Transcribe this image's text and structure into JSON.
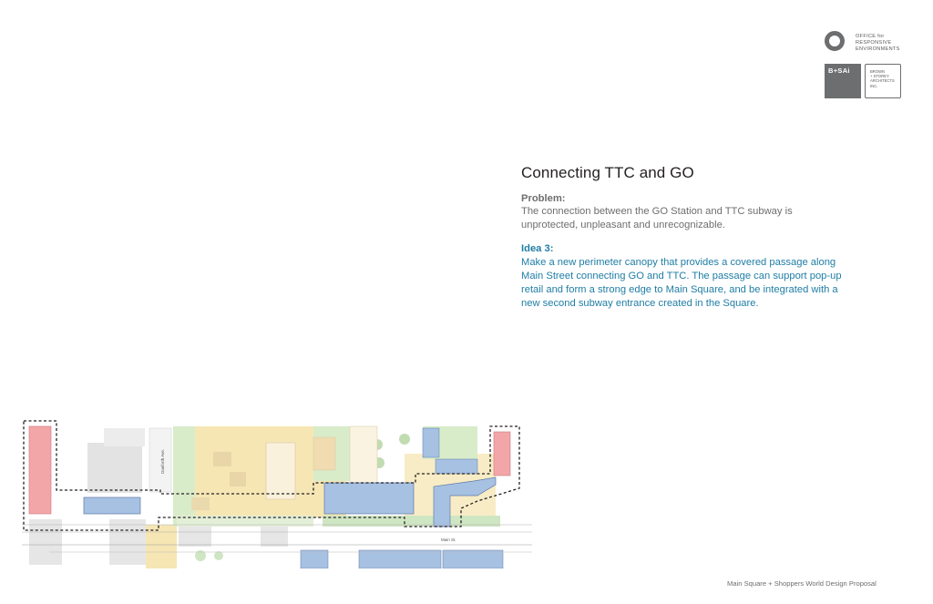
{
  "logo": {
    "ore_lines": [
      "OFFICE for",
      "RESPONSIVE",
      "ENVIRONMENTS"
    ],
    "bsai": "B+SAi",
    "bsa_lines": [
      "BROWN",
      "+ STOREY",
      "ARCHITECTS",
      "INC."
    ]
  },
  "slide": {
    "title": "Connecting TTC and GO",
    "problem_heading": "Problem:",
    "problem_body": "The connection between the GO Station and TTC subway is unprotected, unpleasant and unrecognizable.",
    "idea_heading": "Idea 3:",
    "idea_body": "Make a new perimeter canopy that provides a covered passage along Main Street connecting GO and TTC. The passage can support pop-up retail and form a strong edge to Main Square, and be integrated with a new second subway entrance created in the Square."
  },
  "plan": {
    "street_vertical": "Danforth Ave.",
    "street_horizontal": "Main St."
  },
  "footer": "Main Square + Shoppers World Design Proposal",
  "colors": {
    "title": "#231f20",
    "body_gray": "#6d6e70",
    "accent_blue": "#1f7da5",
    "canopy_blue": "#a7c1e3",
    "station_pink": "#f3a6a8",
    "plaza_yellow": "#f6e6b4",
    "park_green": "#cfe6c3"
  }
}
